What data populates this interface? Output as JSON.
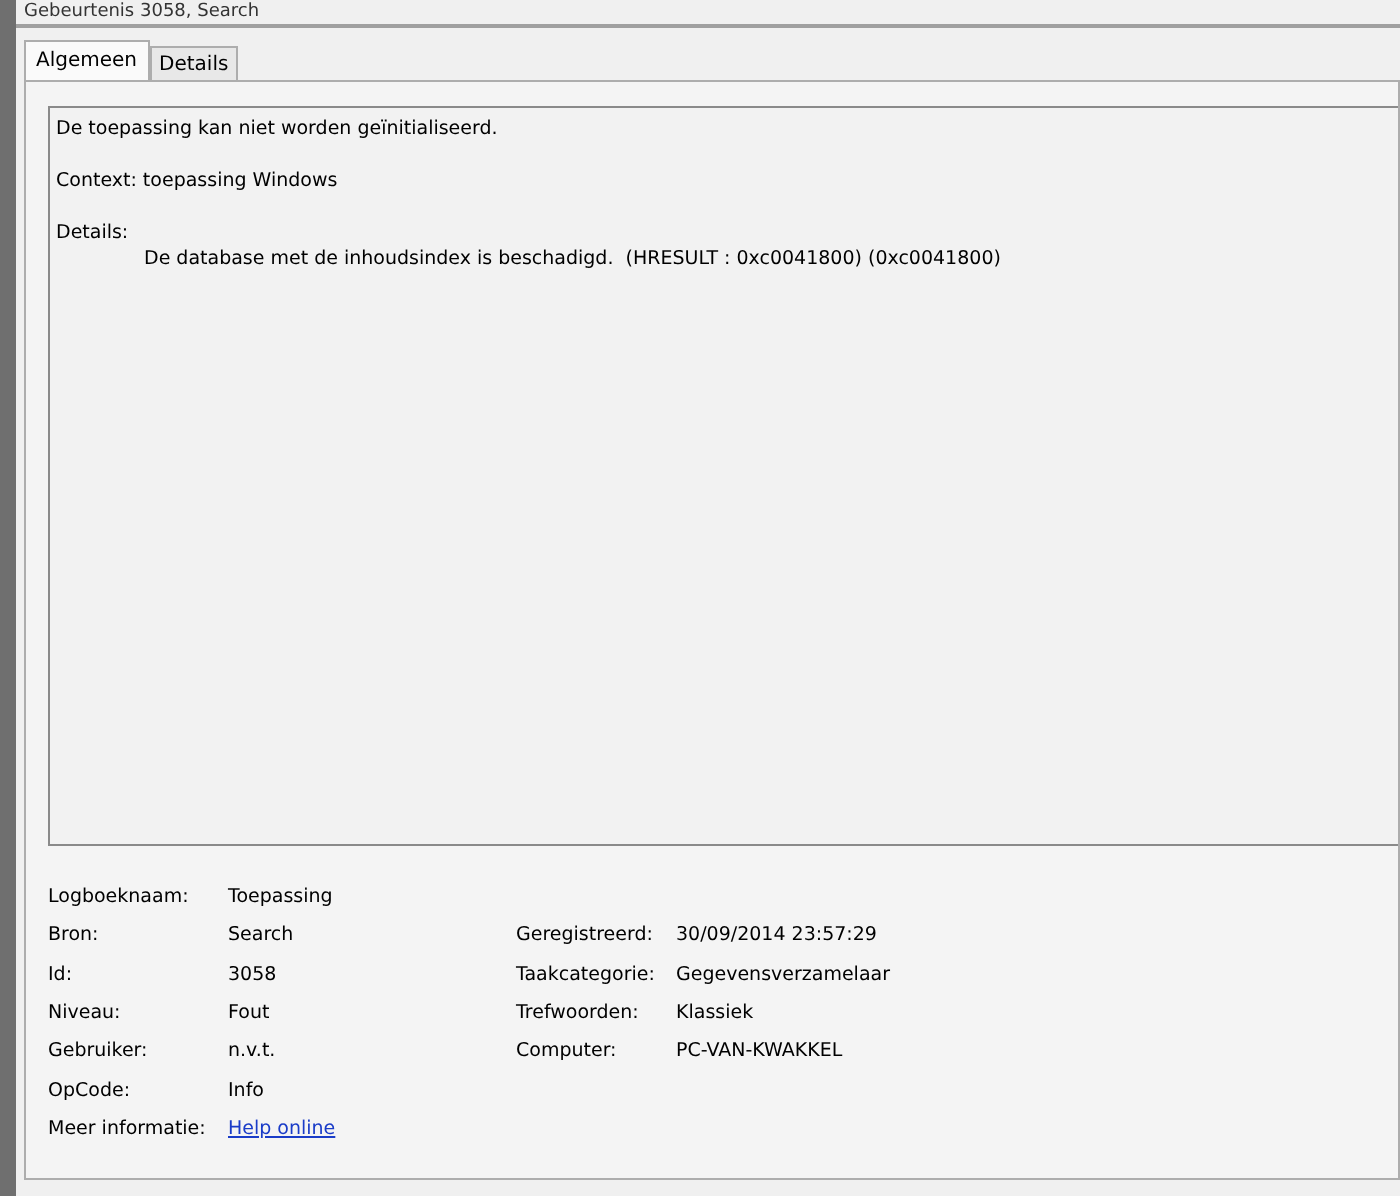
{
  "window": {
    "title": "Gebeurtenis 3058, Search"
  },
  "tabs": [
    {
      "label": "Algemeen",
      "selected": true
    },
    {
      "label": "Details",
      "selected": false
    }
  ],
  "message": {
    "lines": [
      {
        "kind": "text",
        "text": "De toepassing kan niet worden geïnitialiseerd."
      },
      {
        "kind": "text",
        "text": "Context: toepassing Windows"
      },
      {
        "kind": "text",
        "text": "Details:"
      },
      {
        "kind": "indent",
        "text": "De database met de inhoudsindex is beschadigd.  (HRESULT : 0xc0041800) (0xc0041800)"
      }
    ]
  },
  "properties": [
    {
      "left": {
        "label": "Logboeknaam:",
        "value": "Toepassing",
        "kind": "text"
      }
    },
    {
      "left": {
        "label": "Bron:",
        "value": "Search",
        "kind": "text"
      },
      "right": {
        "label": "Geregistreerd:",
        "value": "30/09/2014 23:57:29"
      }
    },
    {
      "left": {
        "label": "Id:",
        "value": "3058",
        "kind": "text"
      },
      "right": {
        "label": "Taakcategorie:",
        "value": "Gegevensverzamelaar"
      }
    },
    {
      "left": {
        "label": "Niveau:",
        "value": "Fout",
        "kind": "text"
      },
      "right": {
        "label": "Trefwoorden:",
        "value": "Klassiek"
      }
    },
    {
      "left": {
        "label": "Gebruiker:",
        "value": "n.v.t.",
        "kind": "text"
      },
      "right": {
        "label": "Computer:",
        "value": "PC-VAN-KWAKKEL"
      }
    },
    {
      "left": {
        "label": "OpCode:",
        "value": "Info",
        "kind": "text"
      }
    },
    {
      "left": {
        "label": "Meer informatie:",
        "value": "Help online",
        "kind": "link"
      }
    }
  ]
}
